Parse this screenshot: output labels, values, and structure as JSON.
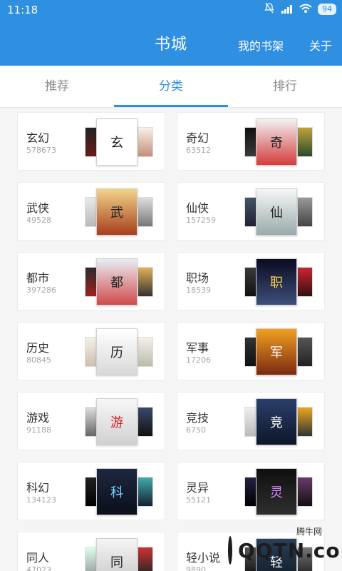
{
  "status_bar": {
    "time": "11:18",
    "battery": "94"
  },
  "app_bar": {
    "title": "书城",
    "shelf_label": "我的书架",
    "about_label": "关于"
  },
  "tabs": [
    {
      "label": "推荐",
      "active": false
    },
    {
      "label": "分类",
      "active": true
    },
    {
      "label": "排行",
      "active": false
    }
  ],
  "colors": {
    "primary": "#2f8fe0"
  },
  "categories": [
    {
      "label": "玄幻",
      "count": "578673"
    },
    {
      "label": "奇幻",
      "count": "63512"
    },
    {
      "label": "武侠",
      "count": "49528"
    },
    {
      "label": "仙侠",
      "count": "157259"
    },
    {
      "label": "都市",
      "count": "397286"
    },
    {
      "label": "职场",
      "count": "18539"
    },
    {
      "label": "历史",
      "count": "80845"
    },
    {
      "label": "军事",
      "count": "17206"
    },
    {
      "label": "游戏",
      "count": "91188"
    },
    {
      "label": "竞技",
      "count": "6750"
    },
    {
      "label": "科幻",
      "count": "134123"
    },
    {
      "label": "灵异",
      "count": "55121"
    },
    {
      "label": "同人",
      "count": "47023"
    },
    {
      "label": "轻小说",
      "count": "9890"
    }
  ],
  "watermark": {
    "small": "腾牛网",
    "big": "QQTN.com"
  },
  "icons": {
    "mute": "bell-off-icon",
    "signal": "signal-icon",
    "wifi": "wifi-icon"
  }
}
